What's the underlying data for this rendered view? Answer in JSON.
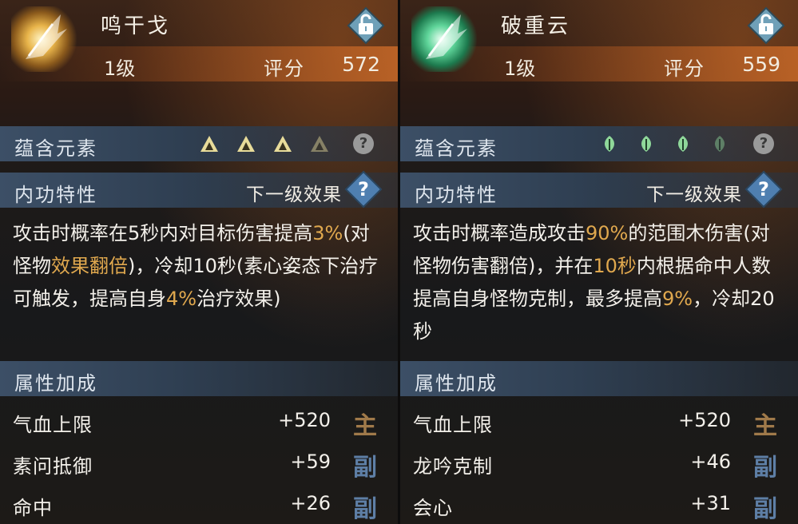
{
  "cards": [
    {
      "name": "鸣干戈",
      "level": "1级",
      "score_label": "评分",
      "score": "572",
      "elements_title": "蕴含元素",
      "element_icon": "mountain-rune-icon",
      "element_color": "#e8dc9a",
      "element_count_active": 3,
      "element_count_total": 4,
      "traits_title": "内功特性",
      "next_level_label": "下一级效果",
      "desc": [
        {
          "t": "攻击时概率在5秒内对目标伤害提高"
        },
        {
          "t": "3%",
          "c": "orange"
        },
        {
          "t": "(对怪物"
        },
        {
          "t": "效果翻倍",
          "c": "orange"
        },
        {
          "t": ")，冷却10秒(素心姿态下治疗可触发，提高自身"
        },
        {
          "t": "4%",
          "c": "orange"
        },
        {
          "t": "治疗效果)"
        }
      ],
      "attrs_title": "属性加成",
      "stats": [
        {
          "name": "气血上限",
          "value": "+520",
          "tag": "主"
        },
        {
          "name": "素问抵御",
          "value": "+59",
          "tag": "副"
        },
        {
          "name": "命中",
          "value": "+26",
          "tag": "副"
        }
      ]
    },
    {
      "name": "破重云",
      "level": "1级",
      "score_label": "评分",
      "score": "559",
      "elements_title": "蕴含元素",
      "element_icon": "leaf-rune-icon",
      "element_color": "#8fd89a",
      "element_count_active": 3,
      "element_count_total": 4,
      "traits_title": "内功特性",
      "next_level_label": "下一级效果",
      "desc": [
        {
          "t": "攻击时概率造成攻击"
        },
        {
          "t": "90%",
          "c": "orange"
        },
        {
          "t": "的范围木伤害(对怪物伤害翻倍)，并在"
        },
        {
          "t": "10秒",
          "c": "orange"
        },
        {
          "t": "内根据命中人数提高自身怪物克制，最多提高"
        },
        {
          "t": "9%",
          "c": "orange"
        },
        {
          "t": "，冷却20秒"
        }
      ],
      "attrs_title": "属性加成",
      "stats": [
        {
          "name": "气血上限",
          "value": "+520",
          "tag": "主"
        },
        {
          "name": "龙吟克制",
          "value": "+46",
          "tag": "副"
        },
        {
          "name": "会心",
          "value": "+31",
          "tag": "副"
        }
      ]
    }
  ],
  "colors": {
    "highlight": "#e0a84e",
    "tag_main": "#a07a4a",
    "tag_sub": "#5e7fa6",
    "section_bar": "#3c4f66",
    "level_bar": "#c8692a"
  }
}
